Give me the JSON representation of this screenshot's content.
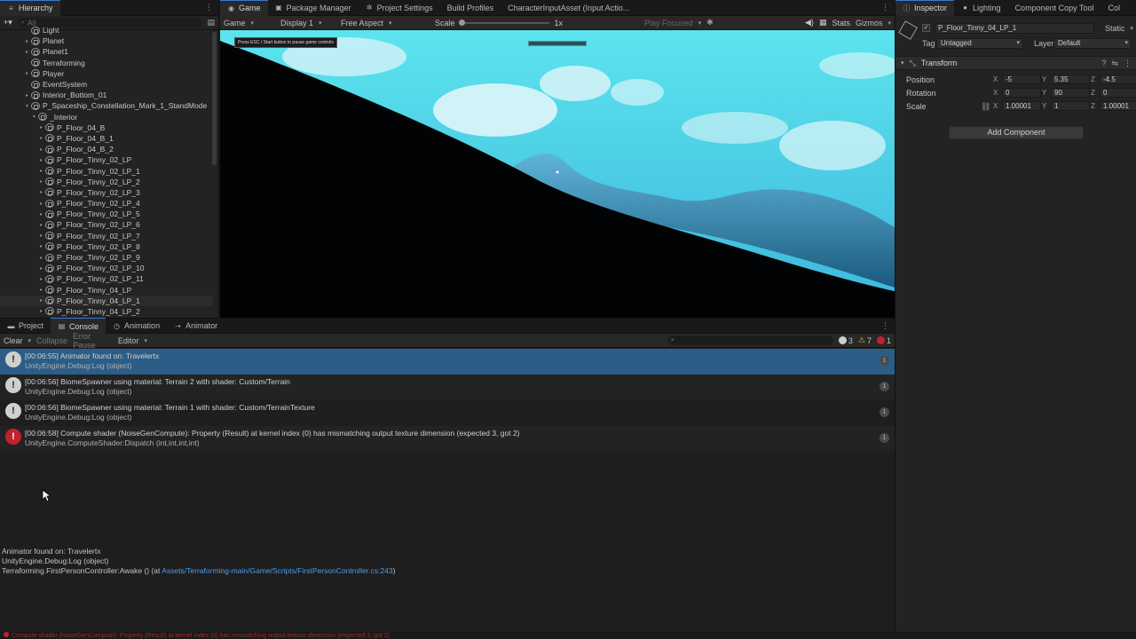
{
  "hierarchy": {
    "tab_label": "Hierarchy",
    "search_placeholder": "All",
    "items": [
      {
        "label": "Light",
        "indent": 2,
        "arrow": "",
        "selected": false
      },
      {
        "label": "Planet",
        "indent": 2,
        "arrow": "▸",
        "selected": false
      },
      {
        "label": "Planet1",
        "indent": 2,
        "arrow": "▸",
        "selected": false
      },
      {
        "label": "Terraforming",
        "indent": 2,
        "arrow": "",
        "selected": false
      },
      {
        "label": "Player",
        "indent": 2,
        "arrow": "▸",
        "selected": false
      },
      {
        "label": "EventSystem",
        "indent": 2,
        "arrow": "",
        "selected": false
      },
      {
        "label": "Interior_Bottom_01",
        "indent": 2,
        "arrow": "▸",
        "selected": false
      },
      {
        "label": "P_Spaceship_Constellation_Mark_1_StandMode",
        "indent": 2,
        "arrow": "▾",
        "selected": false
      },
      {
        "label": "_Interior",
        "indent": 3,
        "arrow": "▾",
        "selected": false
      },
      {
        "label": "P_Floor_04_B",
        "indent": 4,
        "arrow": "▸",
        "selected": false
      },
      {
        "label": "P_Floor_04_B_1",
        "indent": 4,
        "arrow": "▸",
        "selected": false
      },
      {
        "label": "P_Floor_04_B_2",
        "indent": 4,
        "arrow": "▸",
        "selected": false
      },
      {
        "label": "P_Floor_Tinny_02_LP",
        "indent": 4,
        "arrow": "▸",
        "selected": false
      },
      {
        "label": "P_Floor_Tinny_02_LP_1",
        "indent": 4,
        "arrow": "▸",
        "selected": false
      },
      {
        "label": "P_Floor_Tinny_02_LP_2",
        "indent": 4,
        "arrow": "▸",
        "selected": false
      },
      {
        "label": "P_Floor_Tinny_02_LP_3",
        "indent": 4,
        "arrow": "▸",
        "selected": false
      },
      {
        "label": "P_Floor_Tinny_02_LP_4",
        "indent": 4,
        "arrow": "▸",
        "selected": false
      },
      {
        "label": "P_Floor_Tinny_02_LP_5",
        "indent": 4,
        "arrow": "▸",
        "selected": false
      },
      {
        "label": "P_Floor_Tinny_02_LP_6",
        "indent": 4,
        "arrow": "▸",
        "selected": false
      },
      {
        "label": "P_Floor_Tinny_02_LP_7",
        "indent": 4,
        "arrow": "▸",
        "selected": false
      },
      {
        "label": "P_Floor_Tinny_02_LP_8",
        "indent": 4,
        "arrow": "▸",
        "selected": false
      },
      {
        "label": "P_Floor_Tinny_02_LP_9",
        "indent": 4,
        "arrow": "▸",
        "selected": false
      },
      {
        "label": "P_Floor_Tinny_02_LP_10",
        "indent": 4,
        "arrow": "▸",
        "selected": false
      },
      {
        "label": "P_Floor_Tinny_02_LP_11",
        "indent": 4,
        "arrow": "▸",
        "selected": false
      },
      {
        "label": "P_Floor_Tinny_04_LP",
        "indent": 4,
        "arrow": "▸",
        "selected": false
      },
      {
        "label": "P_Floor_Tinny_04_LP_1",
        "indent": 4,
        "arrow": "▸",
        "selected": true
      },
      {
        "label": "P_Floor_Tinny_04_LP_2",
        "indent": 4,
        "arrow": "▸",
        "selected": false
      }
    ]
  },
  "top_tabs": [
    "Game",
    "Package Manager",
    "Project Settings",
    "Build Profiles",
    "CharacterInputAsset (Input Actio..."
  ],
  "game": {
    "mode": "Game",
    "display": "Display 1",
    "aspect": "Free Aspect",
    "scale_label": "Scale",
    "scale_value": "1x",
    "play_focused": "Play Focused",
    "stats": "Stats",
    "gizmos": "Gizmos",
    "overlay_text": "Press ESC / Start button to pause game controls"
  },
  "bottom_tabs": [
    "Project",
    "Console",
    "Animation",
    "Animator"
  ],
  "console": {
    "clear": "Clear",
    "collapse": "Collapse",
    "error_pause": "Error Pause",
    "editor": "Editor",
    "search_value": "",
    "counts": {
      "info": "3",
      "warn": "7",
      "error": "1"
    },
    "logs": [
      {
        "type": "info",
        "line1": "[00:06:55] Animator found on: Travelertx",
        "line2": "UnityEngine.Debug:Log (object)",
        "count": "1",
        "selected": true
      },
      {
        "type": "info",
        "line1": "[00:06:56] BiomeSpawner using material: Terrain 2 with shader: Custom/Terrain",
        "line2": "UnityEngine.Debug:Log (object)",
        "count": "1",
        "selected": false
      },
      {
        "type": "info",
        "line1": "[00:06:56] BiomeSpawner using material: Terrain 1 with shader: Custom/TerrainTexture",
        "line2": "UnityEngine.Debug:Log (object)",
        "count": "1",
        "selected": false
      },
      {
        "type": "error",
        "line1": "[00:06:58] Compute shader (NoiseGenCompute): Property (Result) at kernel index (0) has mismatching output texture dimension (expected 3, got 2)",
        "line2": "UnityEngine.ComputeShader:Dispatch (int,int,int,int)",
        "count": "1",
        "selected": false
      }
    ],
    "detail_line1": "Animator found on: Travelertx",
    "detail_line2": "UnityEngine.Debug:Log (object)",
    "detail_line3_prefix": "Terraforming.FirstPersonController:Awake () (at ",
    "detail_link": "Assets/Terraforming-main/Game/Scripts/FirstPersonController.cs:243",
    "detail_line3_suffix": ")",
    "status_text": "Compute shader (NoiseGenCompute): Property (Result) at kernel index (0) has mismatching output texture dimension (expected 3, got 2)"
  },
  "inspector": {
    "tabs": [
      "Inspector",
      "Lighting",
      "Component Copy Tool",
      "Col"
    ],
    "object_name": "P_Floor_Tinny_04_LP_1",
    "static_label": "Static",
    "tag_label": "Tag",
    "tag_value": "Untagged",
    "layer_label": "Layer",
    "layer_value": "Default",
    "transform_label": "Transform",
    "position_label": "Position",
    "rotation_label": "Rotation",
    "scale_label": "Scale",
    "position": {
      "x": "-5",
      "y": "5.35",
      "z": "-4.5"
    },
    "rotation": {
      "x": "0",
      "y": "90",
      "z": "0"
    },
    "scale": {
      "x": "1.00001",
      "y": "1",
      "z": "1.00001"
    },
    "add_component": "Add Component"
  }
}
